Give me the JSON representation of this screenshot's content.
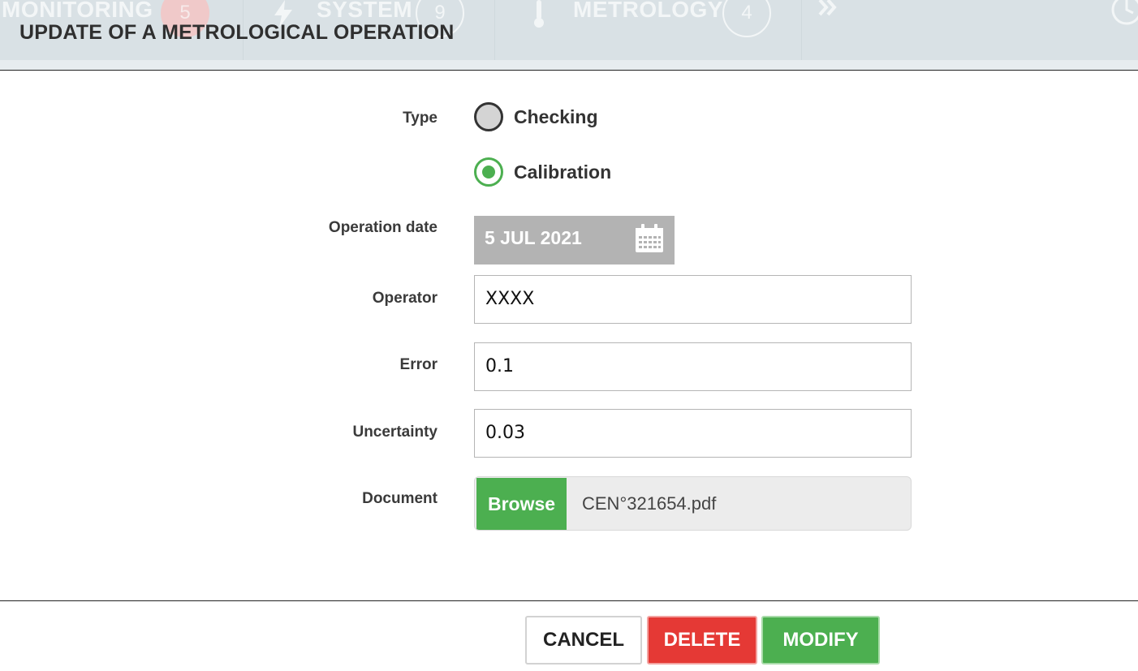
{
  "background_nav": {
    "items": [
      {
        "label": "MONITORING",
        "count": "5"
      },
      {
        "label": "SYSTEM",
        "count": "9"
      },
      {
        "label": "METROLOGY",
        "count": "4"
      }
    ],
    "more_icon": "double-chevron-right-icon",
    "clock_icon": "clock-icon"
  },
  "dialog": {
    "title": "UPDATE OF A METROLOGICAL OPERATION"
  },
  "form": {
    "type": {
      "label": "Type",
      "options": [
        {
          "label": "Checking",
          "checked": false
        },
        {
          "label": "Calibration",
          "checked": true
        }
      ]
    },
    "operation_date": {
      "label": "Operation date",
      "value": "5 JUL 2021",
      "icon": "calendar-icon"
    },
    "operator": {
      "label": "Operator",
      "value": "XXXX"
    },
    "error": {
      "label": "Error",
      "value": "0.1"
    },
    "uncertainty": {
      "label": "Uncertainty",
      "value": "0.03"
    },
    "document": {
      "label": "Document",
      "browse_label": "Browse",
      "filename": "CEN°321654.pdf"
    }
  },
  "buttons": {
    "cancel": "CANCEL",
    "delete": "DELETE",
    "modify": "MODIFY"
  },
  "colors": {
    "accent_green": "#4caf50",
    "danger_red": "#e53935",
    "date_gray": "#b3b3b3"
  }
}
